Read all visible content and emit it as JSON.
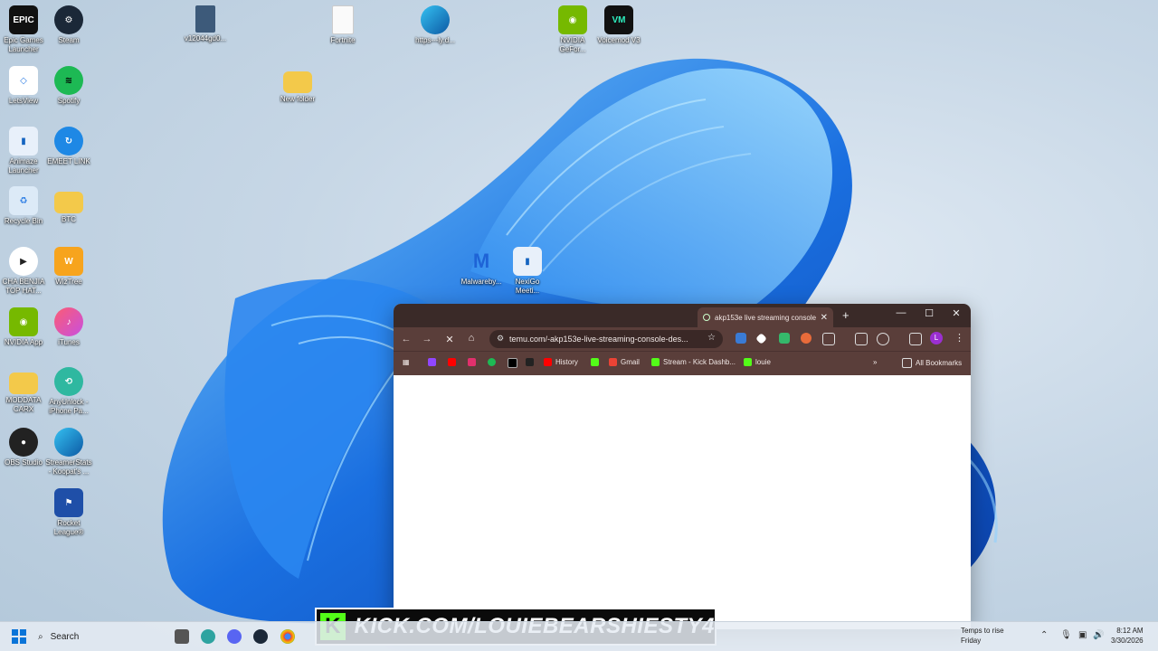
{
  "desktop": {
    "icons": [
      {
        "label": "Epic Games Launcher",
        "icon": "epic-games-icon"
      },
      {
        "label": "Steam",
        "icon": "steam-icon"
      },
      {
        "label": "v12044gd0...",
        "icon": "file-icon"
      },
      {
        "label": "Fortnite",
        "icon": "file-icon"
      },
      {
        "label": "https---ly.d...",
        "icon": "edge-icon"
      },
      {
        "label": "NVIDIA GeFor...",
        "icon": "nvidia-icon"
      },
      {
        "label": "Voicemod V3",
        "icon": "voicemod-icon"
      },
      {
        "label": "LetsView",
        "icon": "letsview-icon"
      },
      {
        "label": "Spotify",
        "icon": "spotify-icon"
      },
      {
        "label": "New folder",
        "icon": "folder-icon"
      },
      {
        "label": "Animaze Launcher",
        "icon": "animaze-icon"
      },
      {
        "label": "EMEET LINK",
        "icon": "emeet-icon"
      },
      {
        "label": "Recycle Bin",
        "icon": "recycle-bin-icon"
      },
      {
        "label": "BTC",
        "icon": "folder-icon"
      },
      {
        "label": "CHA BENJIA TOP HAT...",
        "icon": "video-icon"
      },
      {
        "label": "WizTree",
        "icon": "wiztree-icon"
      },
      {
        "label": "Malwareby...",
        "icon": "malwarebytes-icon"
      },
      {
        "label": "NexiGo Meeti...",
        "icon": "nexigo-icon"
      },
      {
        "label": "NVIDIA App",
        "icon": "nvidia-icon"
      },
      {
        "label": "iTunes",
        "icon": "itunes-icon"
      },
      {
        "label": "MODDATA CARX",
        "icon": "folder-icon"
      },
      {
        "label": "AnyUnlock - iPhone Pa...",
        "icon": "anyunlock-icon"
      },
      {
        "label": "OBS Studio",
        "icon": "obs-icon"
      },
      {
        "label": "StreamerStats - Koopat's ...",
        "icon": "edge-icon"
      },
      {
        "label": "Rocket League®",
        "icon": "rocket-league-icon"
      }
    ]
  },
  "browser": {
    "tab_title": "akp153e live streaming console",
    "url": "temu.com/-akp153e-live-streaming-console-des...",
    "bookmarks": [
      "History",
      "Gmail",
      "Stream - Kick Dashb...",
      "louie"
    ],
    "all_bookmarks_label": "All Bookmarks",
    "profile_initial": "L",
    "colors": {
      "frame": "#3a2a28",
      "toolbar": "#5a3e3a"
    }
  },
  "overlay": {
    "logo": "K",
    "text": "KICK.COM/LOUIEBEARSHIESTY4",
    "accent": "#53fc18"
  },
  "taskbar": {
    "search_label": "Search",
    "weather_line1": "Temps to rise",
    "weather_line2": "Friday",
    "time": "8:12 AM",
    "date": "3/30/2026"
  }
}
